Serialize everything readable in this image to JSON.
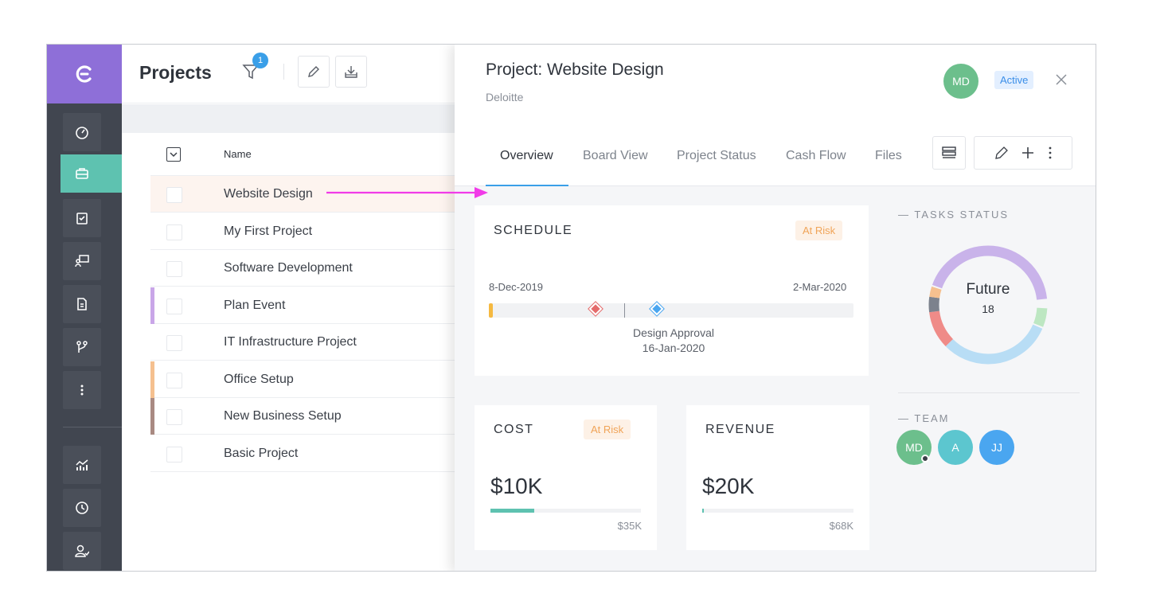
{
  "sidebar": {
    "icons": [
      "logo-icon",
      "dashboard-icon",
      "briefcase-icon",
      "clipboard-icon",
      "presentation-icon",
      "document-icon",
      "branch-icon",
      "more-icon",
      "analytics-icon",
      "clock-icon",
      "user-check-icon"
    ]
  },
  "projects": {
    "title": "Projects",
    "filter_count": "1",
    "column_name": "Name",
    "rows": [
      {
        "name": "Website Design",
        "accent": ""
      },
      {
        "name": "My First Project",
        "accent": ""
      },
      {
        "name": "Software Development",
        "accent": ""
      },
      {
        "name": "Plan Event",
        "accent": "#c9a6e8"
      },
      {
        "name": "IT Infrastructure Project",
        "accent": ""
      },
      {
        "name": "Office Setup",
        "accent": "#f5c08f"
      },
      {
        "name": "New Business Setup",
        "accent": "#a98a82"
      },
      {
        "name": "Basic Project",
        "accent": ""
      }
    ]
  },
  "drawer": {
    "title": "Project: Website Design",
    "client": "Deloitte",
    "owner_initials": "MD",
    "status": "Active",
    "tabs": [
      "Overview",
      "Board View",
      "Project Status",
      "Cash Flow",
      "Files"
    ],
    "schedule": {
      "title": "SCHEDULE",
      "risk": "At Risk",
      "start": "8-Dec-2019",
      "end": "2-Mar-2020",
      "milestone_name": "Design Approval",
      "milestone_date": "16-Jan-2020"
    },
    "cost": {
      "title": "COST",
      "risk": "At Risk",
      "value": "$10K",
      "budget": "$35K",
      "progress": 0.29
    },
    "revenue": {
      "title": "REVENUE",
      "value": "$20K",
      "target": "$68K",
      "progress": 0.01
    },
    "tasks_status": {
      "title": "— TASKS STATUS",
      "center_label": "Future",
      "center_value": "18"
    },
    "team": {
      "title": "— TEAM",
      "members": [
        {
          "initials": "MD",
          "color": "#6cbf8c"
        },
        {
          "initials": "A",
          "color": "#5cc6cf"
        },
        {
          "initials": "JJ",
          "color": "#4aa6f0"
        }
      ]
    }
  },
  "colors": {
    "rail": "#414650",
    "logo": "#8e6fd8",
    "active": "#5ec2b0",
    "accent_blue": "#3a9fe8",
    "arrow": "#f13be8"
  }
}
